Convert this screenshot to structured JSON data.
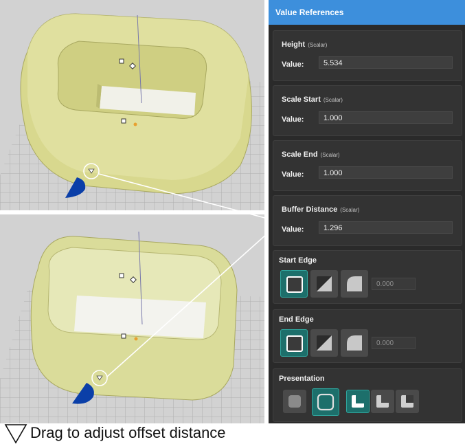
{
  "panel": {
    "title": "Value References",
    "value_cards": [
      {
        "name": "Height",
        "type": "(Scalar)",
        "value_label": "Value:",
        "value": "5.534"
      },
      {
        "name": "Scale Start",
        "type": "(Scalar)",
        "value_label": "Value:",
        "value": "1.000"
      },
      {
        "name": "Scale End",
        "type": "(Scalar)",
        "value_label": "Value:",
        "value": "1.000"
      },
      {
        "name": "Buffer Distance",
        "type": "(Scalar)",
        "value_label": "Value:",
        "value": "1.296"
      }
    ],
    "start_edge": {
      "title": "Start Edge",
      "value": "0.000",
      "selected": "square"
    },
    "end_edge": {
      "title": "End Edge",
      "value": "0.000",
      "selected": "square"
    },
    "presentation": {
      "title": "Presentation",
      "selected_mode": "outline",
      "selected_style": "corner-light"
    }
  },
  "caption": "Drag to adjust offset distance",
  "colors": {
    "header": "#3d8fdc",
    "panel_bg": "#2a2a2a",
    "card_bg": "#333333",
    "active_button": "#1d6f6b",
    "model_face": "#dcdc9a",
    "gizmo": "#0b3fa8",
    "handle_point": "#e8a030"
  },
  "icons": [
    "square-edge-icon",
    "chamfer-edge-icon",
    "round-edge-icon",
    "solid-shape-icon",
    "outline-shape-icon",
    "triangle-handle-icon",
    "cone-gizmo-icon"
  ]
}
